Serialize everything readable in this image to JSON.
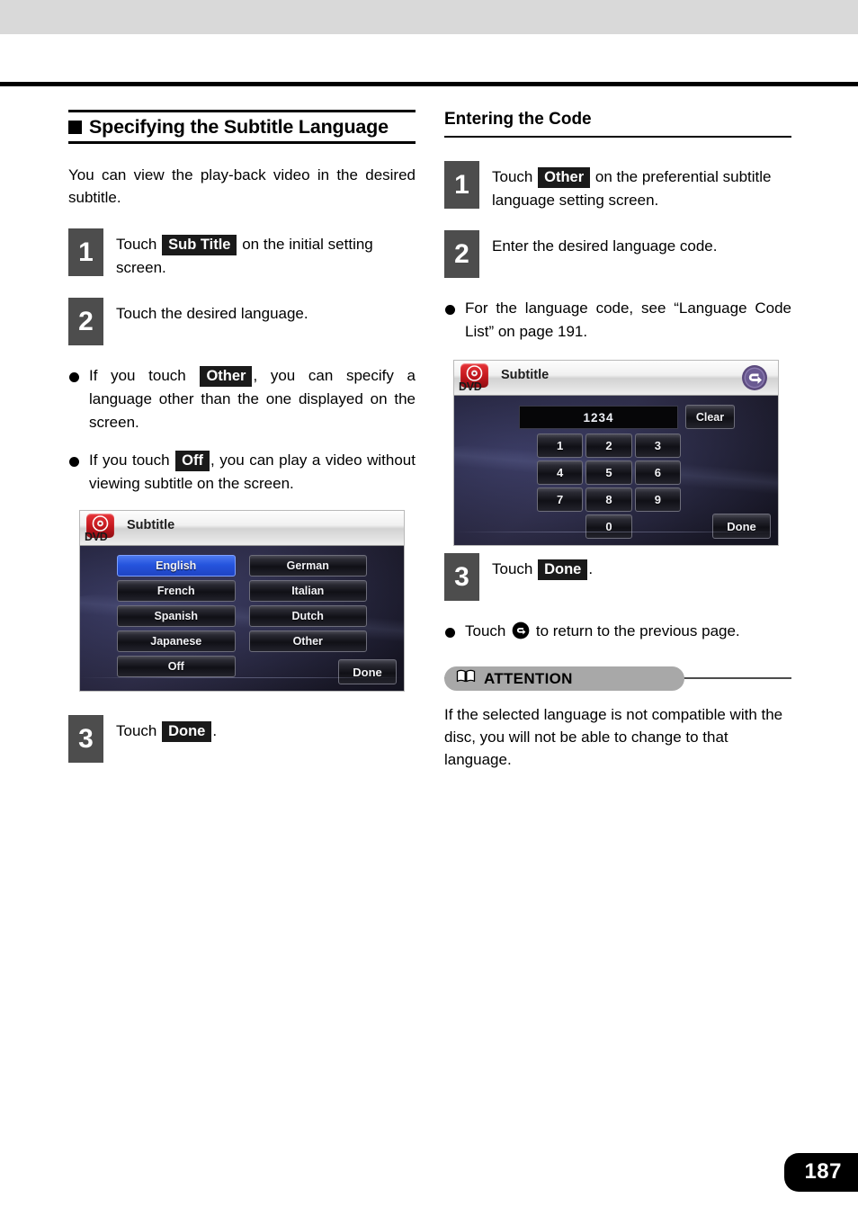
{
  "page": {
    "number": "187"
  },
  "left_column": {
    "section_heading": "Specifying the Subtitle Language",
    "intro_paragraph": "You can view the play-back video in the desired subtitle.",
    "steps": [
      {
        "num": "1",
        "text_before": "Touch",
        "key": "Sub Title",
        "text_after": "on the initial setting screen."
      },
      {
        "num": "2",
        "text_before": "Touch the desired language.",
        "key": "",
        "text_after": ""
      },
      {
        "num": "3",
        "text_before": "Touch",
        "key": "Done",
        "text_after": "."
      }
    ],
    "bullets": [
      {
        "before": "If you touch",
        "key": "Other",
        "after": ", you can specify a language other than the one displayed on the screen."
      },
      {
        "before": "If you touch",
        "key": "Off",
        "after": ", you can play a video without viewing subtitle on the screen."
      }
    ],
    "screenshot": {
      "header_badge": "DVD",
      "header_title": "Subtitle",
      "languages": [
        "English",
        "German",
        "French",
        "Italian",
        "Spanish",
        "Dutch",
        "Japanese",
        "Other",
        "Off",
        ""
      ],
      "selected_language": "English",
      "done_label": "Done"
    }
  },
  "right_column": {
    "section_heading": "Entering the Code",
    "steps": [
      {
        "num": "1",
        "text_before": "Touch",
        "key": "Other",
        "text_after": "on the preferential subtitle language setting screen."
      },
      {
        "num": "2",
        "text_before": "Enter the desired language code.",
        "key": "",
        "text_after": ""
      },
      {
        "num": "3",
        "text_before": "Touch",
        "key": "Done",
        "text_after": "."
      }
    ],
    "bullet_code": "For the language code, see “Language Code List” on page 191.",
    "bullet_return": {
      "before": "Touch",
      "after": "to return to the previous page."
    },
    "screenshot": {
      "header_badge": "DVD",
      "header_title": "Subtitle",
      "code_value": "1234",
      "clear_label": "Clear",
      "keys": [
        "1",
        "2",
        "3",
        "4",
        "5",
        "6",
        "7",
        "8",
        "9",
        "0"
      ],
      "done_label": "Done",
      "back_icon": "back-arrow-icon"
    },
    "attention": {
      "label": "ATTENTION",
      "icon": "open-book-icon",
      "body": "If the selected language is not compatible with the disc, you will not be able to change to that language."
    }
  }
}
